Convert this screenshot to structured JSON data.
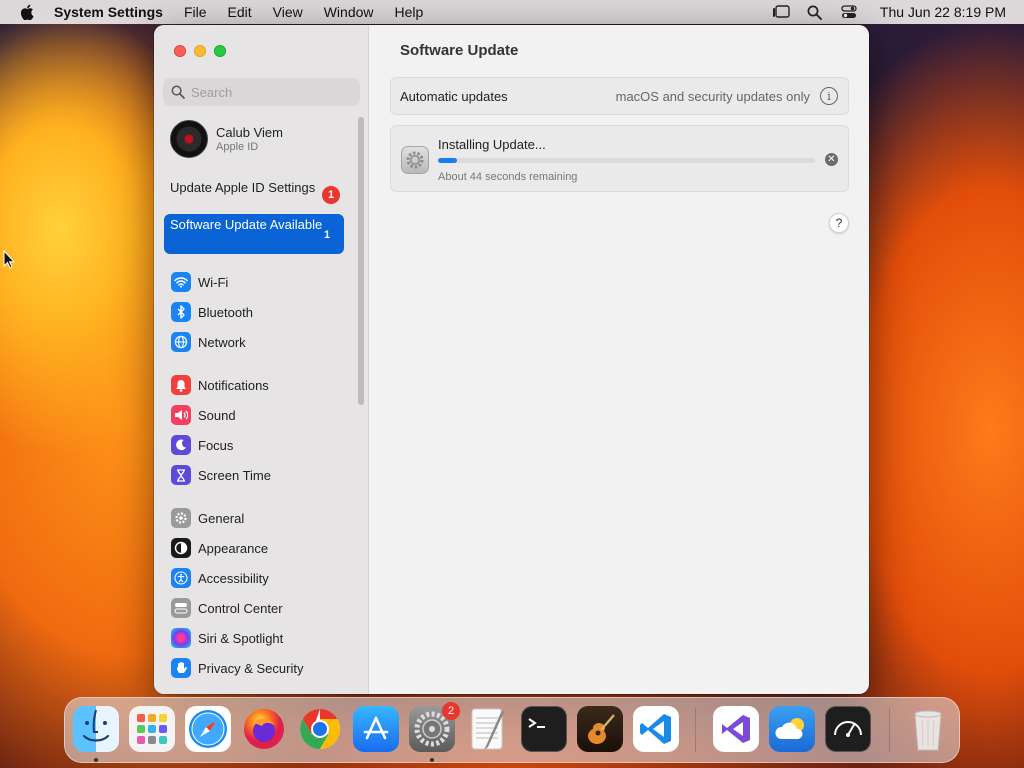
{
  "menubar": {
    "app_name": "System Settings",
    "menus": [
      "File",
      "Edit",
      "View",
      "Window",
      "Help"
    ],
    "clock": "Thu Jun 22  8:19 PM"
  },
  "sidebar": {
    "search_placeholder": "Search",
    "profile": {
      "name": "Calub Viem",
      "subtitle": "Apple ID"
    },
    "notices": [
      {
        "label": "Update Apple ID Settings",
        "badge": "1"
      },
      {
        "label": "Software Update Available",
        "badge": "1"
      }
    ],
    "groups": [
      [
        {
          "label": "Wi-Fi",
          "icon": "wifi-icon",
          "color": "#1a84f5"
        },
        {
          "label": "Bluetooth",
          "icon": "bluetooth-icon",
          "color": "#1a84f5"
        },
        {
          "label": "Network",
          "icon": "globe-icon",
          "color": "#1a84f5"
        }
      ],
      [
        {
          "label": "Notifications",
          "icon": "bell-icon",
          "color": "#f2413d"
        },
        {
          "label": "Sound",
          "icon": "speaker-icon",
          "color": "#f24060"
        },
        {
          "label": "Focus",
          "icon": "moon-icon",
          "color": "#5e4ad8"
        },
        {
          "label": "Screen Time",
          "icon": "hourglass-icon",
          "color": "#5e4ad8"
        }
      ],
      [
        {
          "label": "General",
          "icon": "gear-icon",
          "color": "#9a9a9a"
        },
        {
          "label": "Appearance",
          "icon": "appearance-icon",
          "color": "#1a1a1a"
        },
        {
          "label": "Accessibility",
          "icon": "accessibility-icon",
          "color": "#1a84f5"
        },
        {
          "label": "Control Center",
          "icon": "toggles-icon",
          "color": "#9a9a9a"
        },
        {
          "label": "Siri & Spotlight",
          "icon": "siri-icon",
          "color": "#b43ad6"
        },
        {
          "label": "Privacy & Security",
          "icon": "hand-icon",
          "color": "#1a84f5"
        }
      ]
    ]
  },
  "main": {
    "title": "Software Update",
    "auto_updates": {
      "label": "Automatic updates",
      "value": "macOS and security updates only"
    },
    "install": {
      "title": "Installing Update...",
      "progress": 0.05,
      "remaining": "About 44 seconds remaining"
    },
    "help": "?"
  },
  "dock": {
    "settings_badge": "2",
    "apps": [
      "Finder",
      "Launchpad",
      "Safari",
      "Firefox",
      "Chrome",
      "App Store",
      "System Settings",
      "TextEdit",
      "Terminal",
      "GarageBand",
      "Visual Studio Code",
      "Visual Studio",
      "Weather",
      "Activity Monitor",
      "Trash"
    ]
  },
  "colors": {
    "accent": "#0a64d6",
    "badge": "#e8372c",
    "progress": "#1a7cf0"
  }
}
